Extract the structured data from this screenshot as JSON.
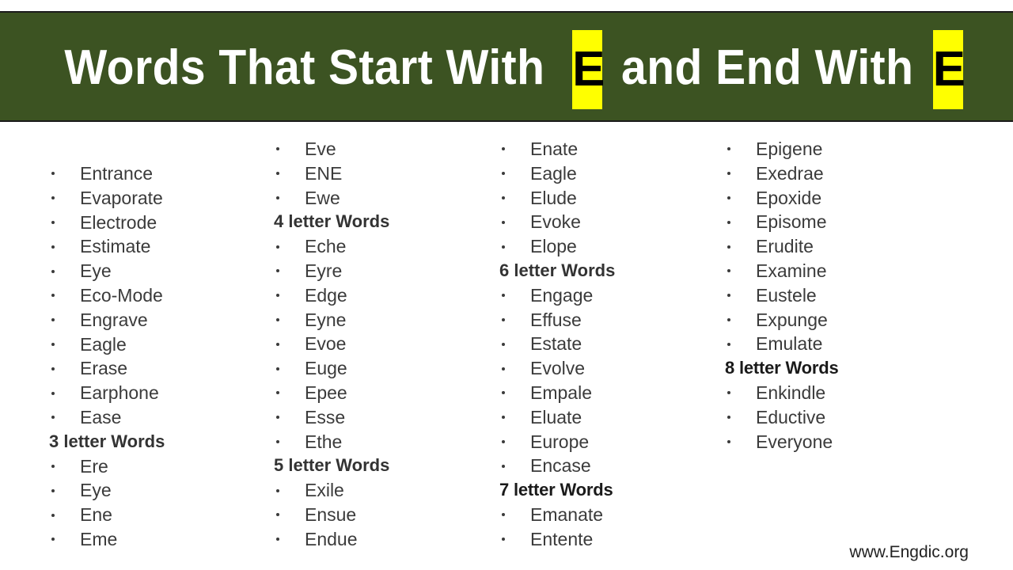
{
  "header": {
    "title_part1": "Words That Start With",
    "highlight1": "E",
    "title_part2": "and End With",
    "highlight2": "E",
    "background_color": "#3C5322",
    "highlight_color": "#FFFF00",
    "title_color": "#FFFFFF"
  },
  "columns": [
    {
      "id": "column-1",
      "blocks": [
        {
          "heading": null,
          "words": [
            "Entrance",
            "Evaporate",
            "Electrode",
            "Estimate",
            "Eye",
            "Eco-Mode",
            "Engrave",
            "Eagle",
            "Erase",
            "Earphone",
            "Ease"
          ]
        },
        {
          "heading": "3 letter Words",
          "heading_style": "bold",
          "words": [
            "Ere",
            "Eye",
            "Ene",
            "Eme"
          ]
        }
      ]
    },
    {
      "id": "column-2",
      "blocks": [
        {
          "heading": null,
          "words": [
            "Eve",
            "ENE",
            "Ewe"
          ]
        },
        {
          "heading": "4 letter Words",
          "heading_style": "bold",
          "words": [
            "Eche",
            "Eyre",
            "Edge",
            "Eyne",
            "Evoe",
            "Euge",
            "Epee",
            "Esse",
            "Ethe"
          ]
        },
        {
          "heading": "5 letter Words",
          "heading_style": "bold",
          "words": [
            "Exile",
            "Ensue",
            "Endue"
          ]
        }
      ]
    },
    {
      "id": "column-3",
      "blocks": [
        {
          "heading": null,
          "words": [
            "Enate",
            "Eagle",
            "Elude",
            "Evoke",
            "Elope"
          ]
        },
        {
          "heading": "6 letter Words",
          "heading_style": "bold",
          "words": [
            "Engage",
            "Effuse",
            "Estate",
            "Evolve",
            "Empale",
            "Eluate",
            "Europe",
            "Encase"
          ]
        },
        {
          "heading": "7 letter Words",
          "heading_style": "narrow",
          "words": [
            "Emanate",
            "Entente"
          ]
        }
      ]
    },
    {
      "id": "column-4",
      "blocks": [
        {
          "heading": null,
          "words": [
            "Epigene",
            "Exedrae",
            "Epoxide",
            "Episome",
            "Erudite",
            "Examine",
            "Eustele",
            "Expunge",
            "Emulate"
          ]
        },
        {
          "heading": "8 letter Words",
          "heading_style": "narrow",
          "words": [
            "Enkindle",
            "Eductive",
            "Everyone"
          ]
        }
      ]
    }
  ],
  "footer": {
    "credit": "www.Engdic.org"
  }
}
